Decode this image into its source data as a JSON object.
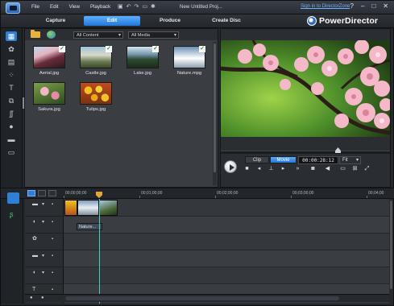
{
  "menu": {
    "items": [
      "File",
      "Edit",
      "View",
      "Playback"
    ],
    "document_title": "New Untitled Proj...",
    "sign_in": "Sign in to DirectorZone",
    "window_buttons": [
      "?",
      "–",
      "□",
      "✕"
    ]
  },
  "modes": {
    "capture": "Capture",
    "edit": "Edit",
    "produce": "Produce",
    "create_disc": "Create Disc"
  },
  "brand": {
    "name": "PowerDirector"
  },
  "library": {
    "filter_content": "All Content",
    "filter_media": "All Media",
    "items": [
      {
        "label": "Aerial.jpg",
        "selected": true
      },
      {
        "label": "Castle.jpg",
        "selected": true
      },
      {
        "label": "Lake.jpg",
        "selected": true
      },
      {
        "label": "Nature.mpg",
        "selected": true
      },
      {
        "label": "Sakura.jpg",
        "selected": false
      },
      {
        "label": "Tulips.jpg",
        "selected": false
      }
    ]
  },
  "preview": {
    "clip_label": "Clip",
    "movie_label": "Movie",
    "timecode": "00:00:28:12",
    "fit": "Fit",
    "seek_position_fraction": 0.69
  },
  "timeline": {
    "ruler": [
      "00;00;00;00",
      "00;01;00;00",
      "00;02;00;00",
      "00;03;00;00",
      "00;04;00"
    ],
    "title_clip": "Nature..."
  },
  "colors": {
    "accent": "#2f7fd8",
    "background": "#25282d",
    "playhead": "#39d3c2"
  }
}
